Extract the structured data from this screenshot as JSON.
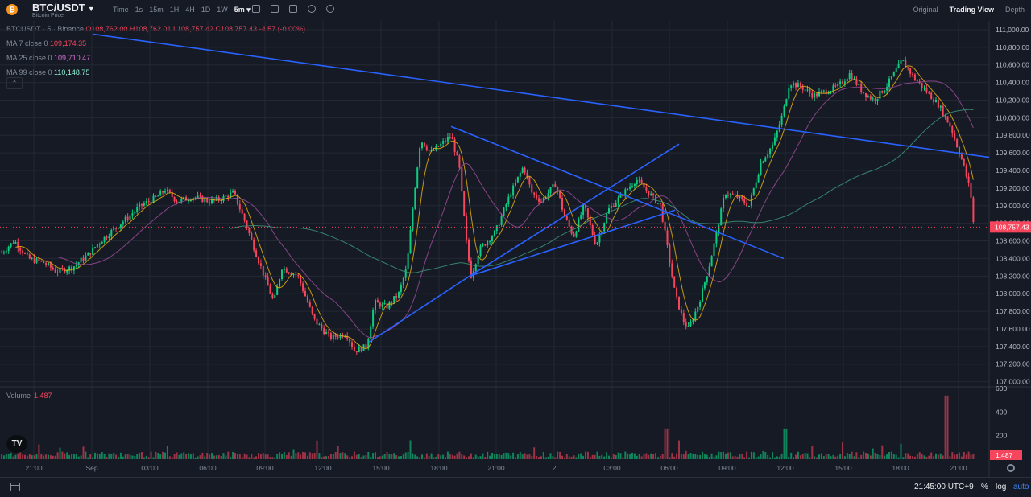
{
  "header": {
    "symbol": "BTC/USDT",
    "subtitle": "Bitcoin Price",
    "logo": "₿",
    "intervals": [
      "Time",
      "1s",
      "15m",
      "1H",
      "4H",
      "1D",
      "1W",
      "5m ▾"
    ],
    "active_interval": "5m ▾",
    "views": [
      "Original",
      "Trading View",
      "Depth"
    ],
    "active_view": "Trading View"
  },
  "legend": {
    "title": "BTCUSDT · 5 · Binance",
    "ohlc": "O108,762.00 H108,762.01 L108,757.42 C108,757.43 -4.57 (-0.00%)",
    "ma7_label": "MA 7 close 0",
    "ma7_value": "109,174.35",
    "ma25_label": "MA 25 close 0",
    "ma25_value": "109,710.47",
    "ma99_label": "MA 99 close 0",
    "ma99_value": "110,148.75",
    "collapse": "^"
  },
  "volume": {
    "label": "Volume",
    "value": "1.487"
  },
  "chart_data": {
    "type": "candlestick",
    "y_ticks": [
      "111,000.00",
      "110,800.00",
      "110,600.00",
      "110,400.00",
      "110,200.00",
      "110,000.00",
      "109,800.00",
      "109,600.00",
      "109,400.00",
      "109,200.00",
      "109,000.00",
      "108,800.00",
      "108,600.00",
      "108,400.00",
      "108,200.00",
      "108,000.00",
      "107,800.00",
      "107,600.00",
      "107,400.00",
      "107,200.00",
      "107,000.00"
    ],
    "ylim": [
      106960,
      111100
    ],
    "current_price": "108,757.43",
    "x_ticks": [
      "21:00",
      "Sep",
      "03:00",
      "06:00",
      "09:00",
      "12:00",
      "15:00",
      "18:00",
      "21:00",
      "2",
      "03:00",
      "06:00",
      "09:00",
      "12:00",
      "15:00",
      "18:00",
      "21:00"
    ],
    "volume_ticks": [
      "600",
      "400",
      "200"
    ],
    "volume_current": "1.487",
    "volume_ylim": [
      0,
      600
    ],
    "price_path": [
      [
        0,
        108450
      ],
      [
        18,
        108600
      ],
      [
        35,
        108400
      ],
      [
        55,
        108350
      ],
      [
        70,
        108250
      ],
      [
        90,
        108300
      ],
      [
        110,
        108450
      ],
      [
        125,
        108600
      ],
      [
        150,
        108800
      ],
      [
        175,
        109000
      ],
      [
        195,
        109100
      ],
      [
        205,
        109180
      ],
      [
        220,
        109050
      ],
      [
        240,
        109100
      ],
      [
        260,
        109050
      ],
      [
        275,
        109080
      ],
      [
        290,
        109150
      ],
      [
        305,
        108800
      ],
      [
        320,
        108400
      ],
      [
        340,
        107900
      ],
      [
        350,
        108300
      ],
      [
        370,
        108200
      ],
      [
        390,
        107700
      ],
      [
        410,
        107500
      ],
      [
        430,
        107550
      ],
      [
        440,
        107350
      ],
      [
        455,
        107400
      ],
      [
        465,
        107900
      ],
      [
        480,
        107850
      ],
      [
        495,
        108000
      ],
      [
        505,
        108300
      ],
      [
        515,
        109200
      ],
      [
        522,
        109750
      ],
      [
        535,
        109600
      ],
      [
        548,
        109700
      ],
      [
        560,
        109800
      ],
      [
        570,
        109450
      ],
      [
        580,
        108500
      ],
      [
        585,
        108200
      ],
      [
        595,
        108500
      ],
      [
        615,
        108700
      ],
      [
        632,
        109100
      ],
      [
        650,
        109450
      ],
      [
        660,
        109150
      ],
      [
        672,
        109050
      ],
      [
        690,
        109250
      ],
      [
        700,
        108900
      ],
      [
        712,
        108650
      ],
      [
        725,
        109000
      ],
      [
        740,
        108550
      ],
      [
        755,
        108950
      ],
      [
        770,
        109100
      ],
      [
        790,
        109300
      ],
      [
        805,
        109150
      ],
      [
        820,
        109000
      ],
      [
        828,
        108550
      ],
      [
        838,
        108000
      ],
      [
        848,
        107700
      ],
      [
        855,
        107600
      ],
      [
        868,
        107900
      ],
      [
        880,
        108300
      ],
      [
        890,
        108700
      ],
      [
        900,
        109150
      ],
      [
        915,
        109100
      ],
      [
        930,
        109000
      ],
      [
        945,
        109500
      ],
      [
        960,
        109700
      ],
      [
        972,
        110050
      ],
      [
        980,
        110400
      ],
      [
        995,
        110350
      ],
      [
        1010,
        110250
      ],
      [
        1025,
        110300
      ],
      [
        1040,
        110350
      ],
      [
        1055,
        110500
      ],
      [
        1070,
        110300
      ],
      [
        1085,
        110200
      ],
      [
        1100,
        110350
      ],
      [
        1110,
        110500
      ],
      [
        1120,
        110650
      ],
      [
        1135,
        110450
      ],
      [
        1150,
        110300
      ],
      [
        1165,
        110150
      ],
      [
        1180,
        109900
      ],
      [
        1195,
        109500
      ],
      [
        1205,
        109150
      ],
      [
        1209,
        108757
      ]
    ],
    "trend_lines": [
      [
        [
          115,
          110950
        ],
        [
          1228,
          109550
        ]
      ],
      [
        [
          560,
          109900
        ],
        [
          973,
          108400
        ]
      ],
      [
        [
          583,
          108200
        ],
        [
          843,
          109700
        ]
      ],
      [
        [
          583,
          108200
        ],
        [
          838,
          108950
        ]
      ],
      [
        [
          458,
          107450
        ],
        [
          583,
          108200
        ]
      ]
    ],
    "series": [
      {
        "name": "MA 7 close 0",
        "color": "#f0b90b"
      },
      {
        "name": "MA 25 close 0",
        "color": "#d56ecf"
      },
      {
        "name": "MA 99 close 0",
        "color": "#4fbf9f"
      }
    ],
    "colors": {
      "up": "#0ecb81",
      "down": "#f6465d",
      "trend": "#2962ff",
      "grid": "#232834"
    }
  },
  "footer": {
    "tv_logo": "TV",
    "time": "21:45:00 UTC+9",
    "percent": "%",
    "log": "log",
    "auto": "auto"
  }
}
